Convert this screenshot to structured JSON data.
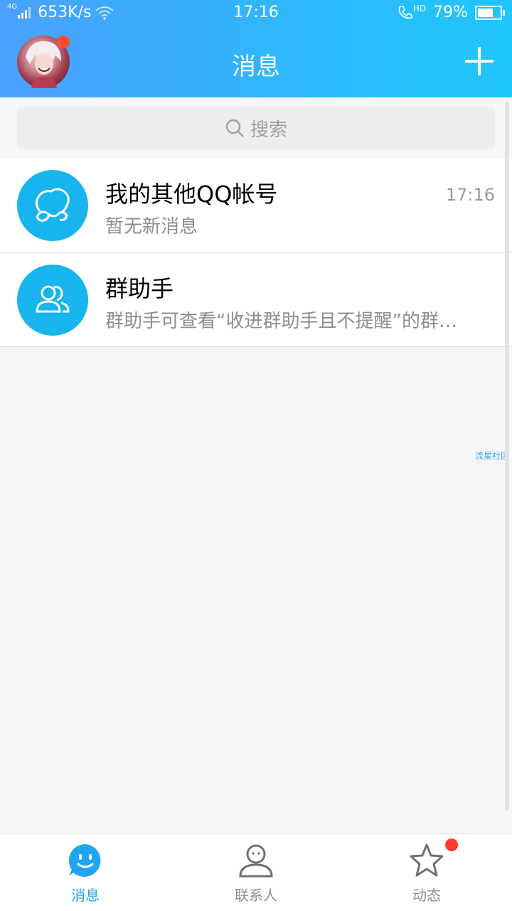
{
  "status_bar": {
    "network": "4G",
    "speed": "653K/s",
    "time": "17:16",
    "call_badge": "HD",
    "battery": "79%",
    "battery_level": 0.79,
    "icons": [
      "signal-icon",
      "wifi-icon",
      "phone-hd-icon",
      "battery-icon"
    ]
  },
  "header": {
    "title": "消息",
    "avatar_has_badge": true,
    "add_icon": "plus-icon"
  },
  "search": {
    "placeholder": "搜索",
    "icon": "search-icon"
  },
  "conversations": [
    {
      "title": "我的其他QQ帐号",
      "subtitle": "暂无新消息",
      "time": "17:16",
      "icon": "multi-account-icon"
    },
    {
      "title": "群助手",
      "subtitle": "群助手可查看“收进群助手且不提醒”的群…",
      "time": "",
      "icon": "group-helper-icon"
    }
  ],
  "watermark": "流星社区",
  "tabbar": {
    "tabs": [
      {
        "label": "消息",
        "icon": "message-icon",
        "active": true,
        "badge": false
      },
      {
        "label": "联系人",
        "icon": "contacts-icon",
        "active": false,
        "badge": false
      },
      {
        "label": "动态",
        "icon": "star-icon",
        "active": false,
        "badge": true
      }
    ]
  },
  "colors": {
    "header_gradient_start": "#4aa0ff",
    "header_gradient_end": "#20c6fb",
    "accent": "#1fa6f0",
    "badge": "#ff3b30",
    "avatar_bg": "#18b4ed"
  }
}
